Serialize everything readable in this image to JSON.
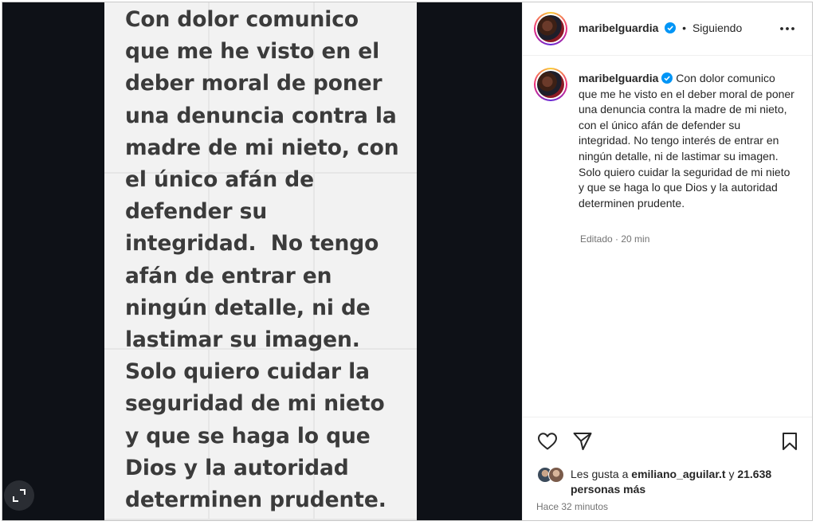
{
  "photo": {
    "text": "Con dolor comunico\nque me he visto en el\ndeber moral de poner\nuna denuncia contra la\nmadre de mi nieto, con\nel único afán de\ndefender su\nintegridad.  No tengo\nafán de entrar en\nningún detalle, ni de\nlastimar su imagen.\nSolo quiero cuidar la\nseguridad de mi nieto\ny que se haga lo que\nDios y la autoridad\ndeterminen prudente."
  },
  "header": {
    "username": "maribelguardia",
    "separator": "•",
    "follow_status": "Siguiendo"
  },
  "caption": {
    "username": "maribelguardia",
    "text": "Con dolor comunico que me he visto en el deber moral de poner una denuncia contra la madre de mi nieto, con el único afán de defender su integridad. No tengo interés de entrar en ningún detalle, ni de lastimar su imagen. Solo quiero cuidar la seguridad de mi nieto y que se haga lo que Dios y la autoridad determinen prudente.",
    "edited": "Editado · 20 min"
  },
  "likes": {
    "prefix": "Les gusta a",
    "user": "emiliano_aguilar.t",
    "conj": "y",
    "count": "21.638 personas más"
  },
  "time_ago": "Hace 32 minutos",
  "icons": {
    "expand": "expand-icon",
    "verified": "verified-badge-icon",
    "more": "more-options-icon",
    "like": "heart-icon",
    "share": "send-icon",
    "save": "bookmark-icon"
  },
  "colors": {
    "verified": "#0095f6",
    "secondary_text": "#737373",
    "primary_text": "#262626"
  }
}
